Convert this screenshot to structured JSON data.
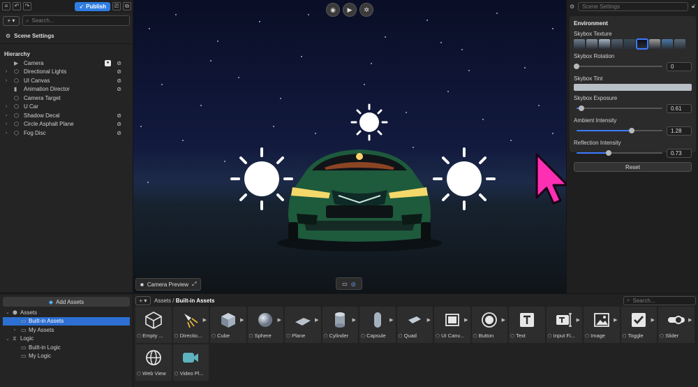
{
  "toolbar": {
    "publish_label": "Publish",
    "left_icons": [
      "menu-icon",
      "undo-icon",
      "redo-icon"
    ],
    "right_icons": [
      "preview-icon",
      "share-icon"
    ]
  },
  "hierarchy_panel": {
    "add_button": "+ ▾",
    "search_placeholder": "Search...",
    "scene_settings_label": "Scene Settings",
    "title": "Hierarchy",
    "items": [
      {
        "label": "Camera",
        "expandable": false,
        "icon": "camera-icon",
        "visibility": true,
        "camera_badge": true
      },
      {
        "label": "Directional Lights",
        "expandable": true,
        "icon": "object-icon",
        "visibility": true
      },
      {
        "label": "UI Canvas",
        "expandable": true,
        "icon": "object-icon",
        "visibility": true
      },
      {
        "label": "Animation Director",
        "expandable": false,
        "icon": "director-icon",
        "visibility": true
      },
      {
        "label": "Camera Target",
        "expandable": false,
        "icon": "object-icon",
        "visibility": false
      },
      {
        "label": "U Car",
        "expandable": true,
        "icon": "object-icon",
        "visibility": false
      },
      {
        "label": "Shadow Decal",
        "expandable": true,
        "icon": "object-icon",
        "visibility": true
      },
      {
        "label": "Circle Asphalt Plane",
        "expandable": true,
        "icon": "object-icon",
        "visibility": true
      },
      {
        "label": "Fog Disc",
        "expandable": true,
        "icon": "object-icon",
        "visibility": true
      }
    ]
  },
  "viewport": {
    "controls": [
      "screenshot-icon",
      "play-icon",
      "debug-icon"
    ],
    "camera_preview_label": "Camera Preview"
  },
  "scene_settings": {
    "header": "Scene Settings",
    "section_title": "Environment",
    "skybox_texture_label": "Skybox Texture",
    "skybox_thumbnails": [
      "#6d7d8e",
      "#8a929c",
      "#a8b4c6",
      "#55606e",
      "#3a4a56",
      "#0d0d18",
      "#9a9a9a",
      "#4a78a8",
      "#5a6a78"
    ],
    "skybox_selected_index": 5,
    "skybox_rotation_label": "Skybox Rotation",
    "skybox_rotation_value": "0",
    "skybox_rotation_fraction": 0.0,
    "skybox_tint_label": "Skybox Tint",
    "skybox_tint_color": "#b9bfc7",
    "skybox_exposure_label": "Skybox Exposure",
    "skybox_exposure_value": "0.61",
    "skybox_exposure_fraction": 0.06,
    "ambient_intensity_label": "Ambient Intensity",
    "ambient_intensity_value": "1.28",
    "ambient_intensity_fraction": 0.64,
    "reflection_intensity_label": "Reflection Intensity",
    "reflection_intensity_value": "0.73",
    "reflection_intensity_fraction": 0.37,
    "reset_label": "Reset"
  },
  "assets_panel": {
    "add_assets_label": "Add Assets",
    "tree": [
      {
        "label": "Assets",
        "level": 0,
        "expanded": true,
        "icon": "cube-icon"
      },
      {
        "label": "Built-in Assets",
        "level": 1,
        "selected": true,
        "icon": "folder-icon"
      },
      {
        "label": "My Assets",
        "level": 1,
        "expandable": true,
        "icon": "folder-icon"
      },
      {
        "label": "Logic",
        "level": 0,
        "expanded": true,
        "icon": "logic-icon"
      },
      {
        "label": "Built-in Logic",
        "level": 1,
        "icon": "folder-icon"
      },
      {
        "label": "My Logic",
        "level": 1,
        "icon": "folder-icon"
      }
    ],
    "breadcrumb_root": "Assets",
    "breadcrumb_sep": "/",
    "breadcrumb_current": "Built-in Assets",
    "search_placeholder": "Search...",
    "tiles": [
      {
        "label": "Empty ...",
        "icon": "empty-object-icon"
      },
      {
        "label": "Directio...",
        "icon": "directional-light-icon"
      },
      {
        "label": "Cube",
        "icon": "cube-icon"
      },
      {
        "label": "Sphere",
        "icon": "sphere-icon"
      },
      {
        "label": "Plane",
        "icon": "plane-icon"
      },
      {
        "label": "Cylinder",
        "icon": "cylinder-icon"
      },
      {
        "label": "Capsule",
        "icon": "capsule-icon"
      },
      {
        "label": "Quad",
        "icon": "quad-icon"
      },
      {
        "label": "UI Canv...",
        "icon": "ui-canvas-icon"
      },
      {
        "label": "Button",
        "icon": "button-icon"
      },
      {
        "label": "Text",
        "icon": "text-icon"
      },
      {
        "label": "Input Fi...",
        "icon": "input-field-icon"
      },
      {
        "label": "Image",
        "icon": "image-icon"
      },
      {
        "label": "Toggle",
        "icon": "toggle-icon"
      },
      {
        "label": "Slider",
        "icon": "slider-icon"
      },
      {
        "label": "Web View",
        "icon": "web-view-icon"
      },
      {
        "label": "Video Pl...",
        "icon": "video-player-icon"
      }
    ]
  },
  "colors": {
    "accent": "#2f7de1",
    "selection": "#2d6fd2",
    "cursor": "#ff2fb3"
  }
}
